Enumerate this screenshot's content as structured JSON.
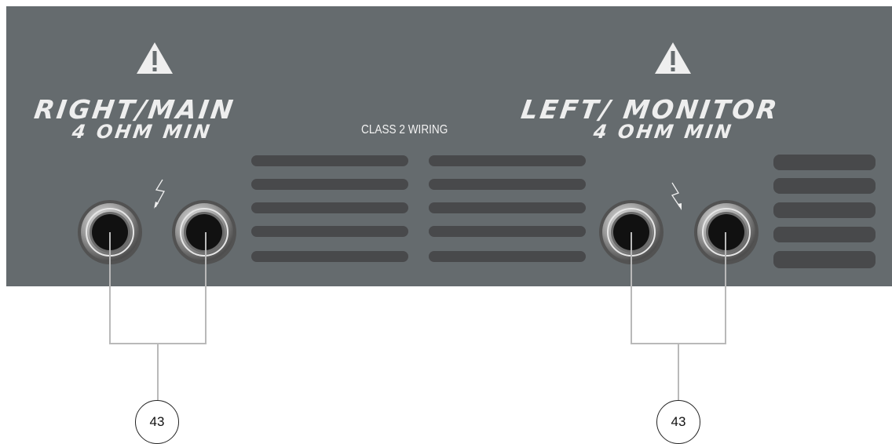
{
  "panel": {
    "right_label_line1": "RIGHT/MAIN",
    "right_label_line2": "4 OHM MIN",
    "left_label_line1": "LEFT/ MONITOR",
    "left_label_line2": "4 OHM MIN",
    "class_label": "CLASS 2 WIRING"
  },
  "callouts": {
    "left_number": "43",
    "right_number": "43"
  },
  "colors": {
    "panel": "#656b6e",
    "vent": "#48494b",
    "text": "#eeeeee",
    "leader": "#b9b9b9"
  },
  "icons": [
    "warning-icon",
    "lightning-bolt-icon",
    "speaker-jack-icon"
  ]
}
